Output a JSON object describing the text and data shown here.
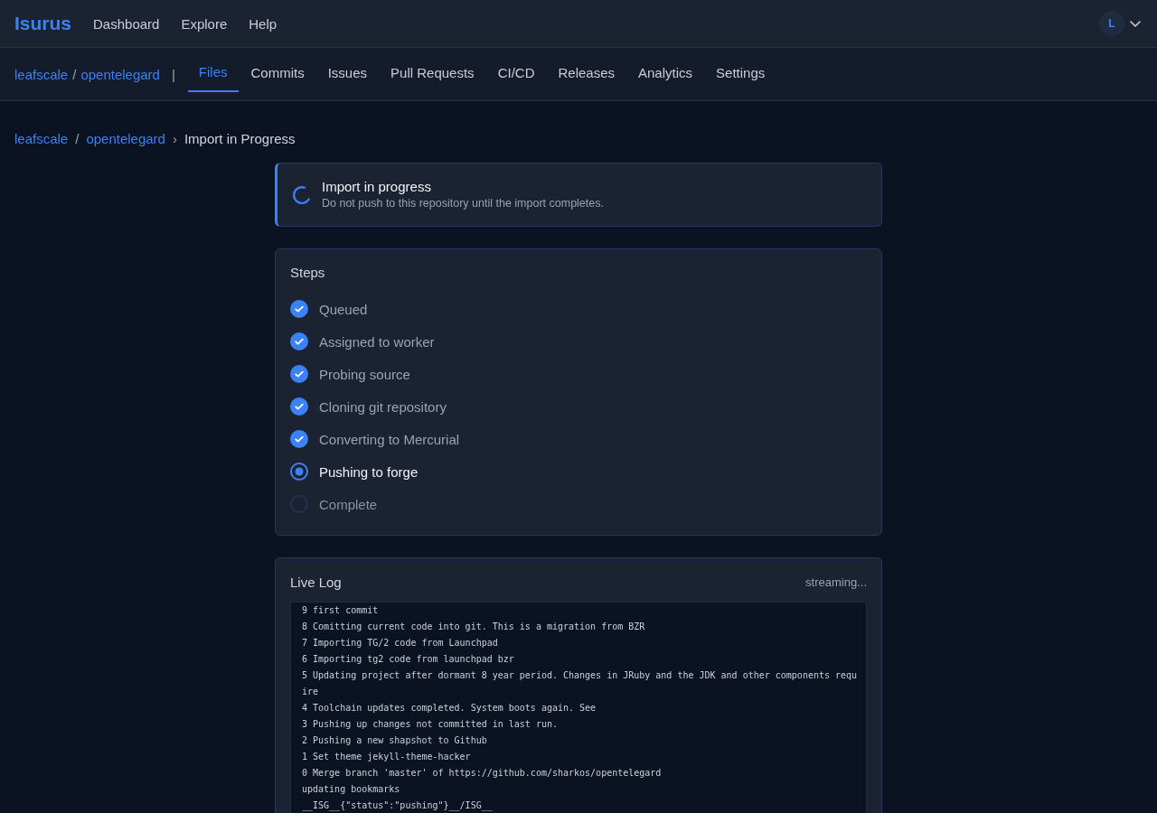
{
  "header": {
    "logo": "Isurus",
    "nav": [
      "Dashboard",
      "Explore",
      "Help"
    ],
    "avatar": {
      "initial": "L"
    }
  },
  "repo_bar": {
    "owner": "leafscale",
    "path_separator": "/",
    "repo": "opentelegard",
    "divider": "|",
    "tabs": [
      {
        "label": "Files",
        "selected": true
      },
      {
        "label": "Commits",
        "selected": false
      },
      {
        "label": "Issues",
        "selected": false
      },
      {
        "label": "Pull Requests",
        "selected": false
      },
      {
        "label": "CI/CD",
        "selected": false
      },
      {
        "label": "Releases",
        "selected": false
      },
      {
        "label": "Analytics",
        "selected": false
      },
      {
        "label": "Settings",
        "selected": false
      }
    ]
  },
  "breadcrumb": {
    "items": [
      {
        "label": "leafscale",
        "kind": "link"
      },
      {
        "label": "opentelegard",
        "kind": "link",
        "separator": "/"
      },
      {
        "label": "Import in Progress",
        "kind": "current",
        "separator": "›"
      }
    ]
  },
  "alert": {
    "title": "Import in progress",
    "message": "Do not push to this repository until the import completes."
  },
  "steps": {
    "title": "Steps",
    "items": [
      {
        "label": "Queued",
        "done": true,
        "current": false
      },
      {
        "label": "Assigned to worker",
        "done": true,
        "current": false
      },
      {
        "label": "Probing source",
        "done": true,
        "current": false
      },
      {
        "label": "Cloning git repository",
        "done": true,
        "current": false
      },
      {
        "label": "Converting to Mercurial",
        "done": true,
        "current": false
      },
      {
        "label": "Pushing to forge",
        "done": false,
        "current": true
      },
      {
        "label": "Complete",
        "done": false,
        "current": false
      }
    ]
  },
  "live_log": {
    "title": "Live Log",
    "status": "streaming...",
    "lines": [
      "9 first commit",
      "8 Comitting current code into git. This is a migration from BZR",
      "7 Importing TG/2 code from Launchpad",
      "6 Importing tg2 code from launchpad bzr",
      "5 Updating project after dormant 8 year period. Changes in JRuby and the JDK and other components require",
      "4 Toolchain updates completed. System boots again. See",
      "3 Pushing up changes not committed in last run.",
      "2 Pushing a new shapshot to Github",
      "1 Set theme jekyll-theme-hacker",
      "0 Merge branch 'master' of https://github.com/sharkos/opentelegard",
      "updating bookmarks",
      "__ISG__{\"status\":\"pushing\"}__/ISG__"
    ]
  }
}
